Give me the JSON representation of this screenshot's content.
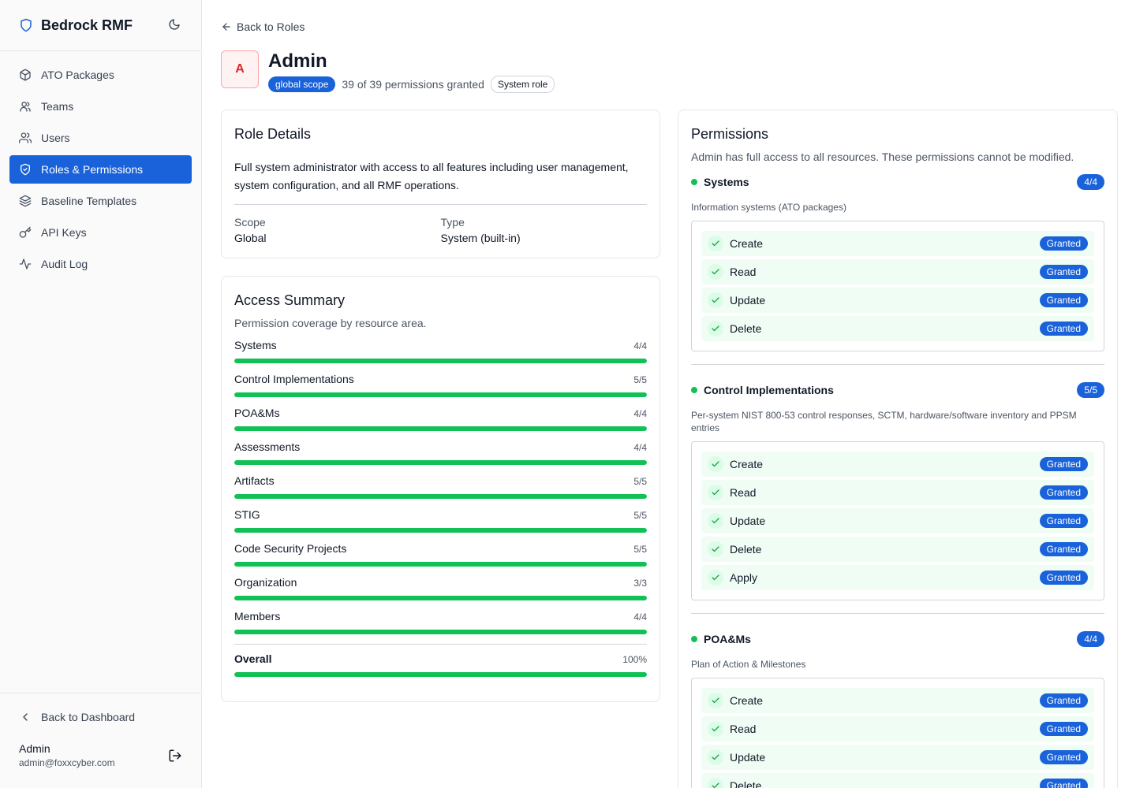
{
  "brand": {
    "name": "Bedrock RMF"
  },
  "nav": [
    {
      "label": "ATO Packages",
      "icon": "package-icon"
    },
    {
      "label": "Teams",
      "icon": "teams-icon"
    },
    {
      "label": "Users",
      "icon": "users-icon"
    },
    {
      "label": "Roles & Permissions",
      "icon": "shield-check-icon",
      "active": true
    },
    {
      "label": "Baseline Templates",
      "icon": "layers-icon"
    },
    {
      "label": "API Keys",
      "icon": "key-icon"
    },
    {
      "label": "Audit Log",
      "icon": "activity-icon"
    }
  ],
  "sidebar_bottom": {
    "back_label": "Back to Dashboard",
    "user_name": "Admin",
    "user_email": "admin@foxxcyber.com"
  },
  "page": {
    "back_label": "Back to Roles",
    "avatar_letter": "A",
    "title": "Admin",
    "scope_badge": "global scope",
    "permission_count": "39 of 39 permissions granted",
    "system_badge": "System role"
  },
  "details": {
    "title": "Role Details",
    "description": "Full system administrator with access to all features including user management, system configuration, and all RMF operations.",
    "scope_label": "Scope",
    "scope_value": "Global",
    "type_label": "Type",
    "type_value": "System (built-in)"
  },
  "summary": {
    "title": "Access Summary",
    "subtitle": "Permission coverage by resource area.",
    "rows": [
      {
        "name": "Systems",
        "count": "4/4",
        "fraction": 1.0
      },
      {
        "name": "Control Implementations",
        "count": "5/5",
        "fraction": 1.0
      },
      {
        "name": "POA&Ms",
        "count": "4/4",
        "fraction": 1.0
      },
      {
        "name": "Assessments",
        "count": "4/4",
        "fraction": 1.0
      },
      {
        "name": "Artifacts",
        "count": "5/5",
        "fraction": 1.0
      },
      {
        "name": "STIG",
        "count": "5/5",
        "fraction": 1.0
      },
      {
        "name": "Code Security Projects",
        "count": "5/5",
        "fraction": 1.0
      },
      {
        "name": "Organization",
        "count": "3/3",
        "fraction": 1.0
      },
      {
        "name": "Members",
        "count": "4/4",
        "fraction": 1.0
      }
    ],
    "overall": {
      "name": "Overall",
      "count": "100%",
      "fraction": 1.0
    }
  },
  "permissions": {
    "title": "Permissions",
    "subtitle": "Admin has full access to all resources. These permissions cannot be modified.",
    "granted_label": "Granted",
    "groups": [
      {
        "name": "Systems",
        "count": "4/4",
        "description": "Information systems (ATO packages)",
        "items": [
          "Create",
          "Read",
          "Update",
          "Delete"
        ]
      },
      {
        "name": "Control Implementations",
        "count": "5/5",
        "description": "Per-system NIST 800-53 control responses, SCTM, hardware/software inventory and PPSM entries",
        "items": [
          "Create",
          "Read",
          "Update",
          "Delete",
          "Apply"
        ]
      },
      {
        "name": "POA&Ms",
        "count": "4/4",
        "description": "Plan of Action & Milestones",
        "items": [
          "Create",
          "Read",
          "Update",
          "Delete"
        ]
      }
    ]
  },
  "colors": {
    "accent": "#1a62da",
    "success": "#12c155",
    "avatar_bg": "#fef2f2",
    "avatar_text": "#dc2626"
  }
}
